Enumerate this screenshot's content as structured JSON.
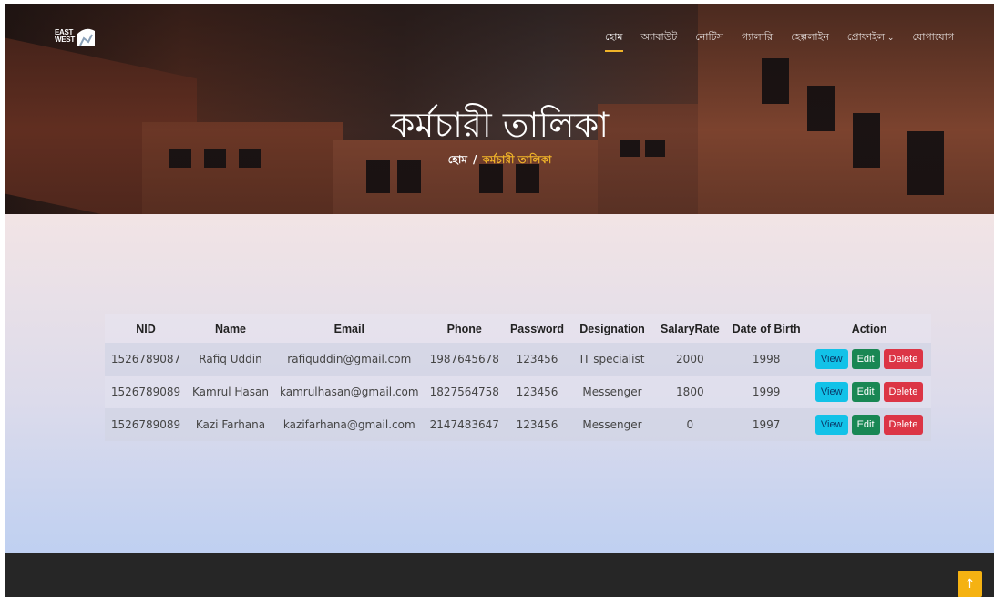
{
  "header": {
    "logo_text": "EAST WEST",
    "nav": [
      {
        "label": "হোম"
      },
      {
        "label": "অ্যাবাউট"
      },
      {
        "label": "নোটিস"
      },
      {
        "label": "গ্যালারি"
      },
      {
        "label": "হেল্পলাইন"
      },
      {
        "label": "প্রোফাইল"
      },
      {
        "label": "যোগাযোগ"
      }
    ]
  },
  "hero": {
    "title": "কর্মচারী তালিকা",
    "breadcrumb_home": "হোম",
    "breadcrumb_sep": "/",
    "breadcrumb_current": "কর্মচারী তালিকা"
  },
  "table": {
    "columns": [
      "NID",
      "Name",
      "Email",
      "Phone",
      "Password",
      "Designation",
      "SalaryRate",
      "Date of Birth",
      "Action"
    ],
    "rows": [
      {
        "nid": "1526789087",
        "name": "Rafiq Uddin",
        "email": "rafiquddin@gmail.com",
        "phone": "1987645678",
        "password": "123456",
        "designation": "IT specialist",
        "salary": "2000",
        "dob": "1998"
      },
      {
        "nid": "1526789089",
        "name": "Kamrul Hasan",
        "email": "kamrulhasan@gmail.com",
        "phone": "1827564758",
        "password": "123456",
        "designation": "Messenger",
        "salary": "1800",
        "dob": "1999"
      },
      {
        "nid": "1526789089",
        "name": "Kazi Farhana",
        "email": "kazifarhana@gmail.com",
        "phone": "2147483647",
        "password": "123456",
        "designation": "Messenger",
        "salary": "0",
        "dob": "1997"
      }
    ],
    "actions": {
      "view": "View",
      "edit": "Edit",
      "delete": "Delete"
    }
  },
  "back_to_top": "↑",
  "colors": {
    "accent": "#f0b429",
    "view": "#12c2e8",
    "edit": "#198754",
    "delete": "#dc3545",
    "footer": "#262626"
  }
}
